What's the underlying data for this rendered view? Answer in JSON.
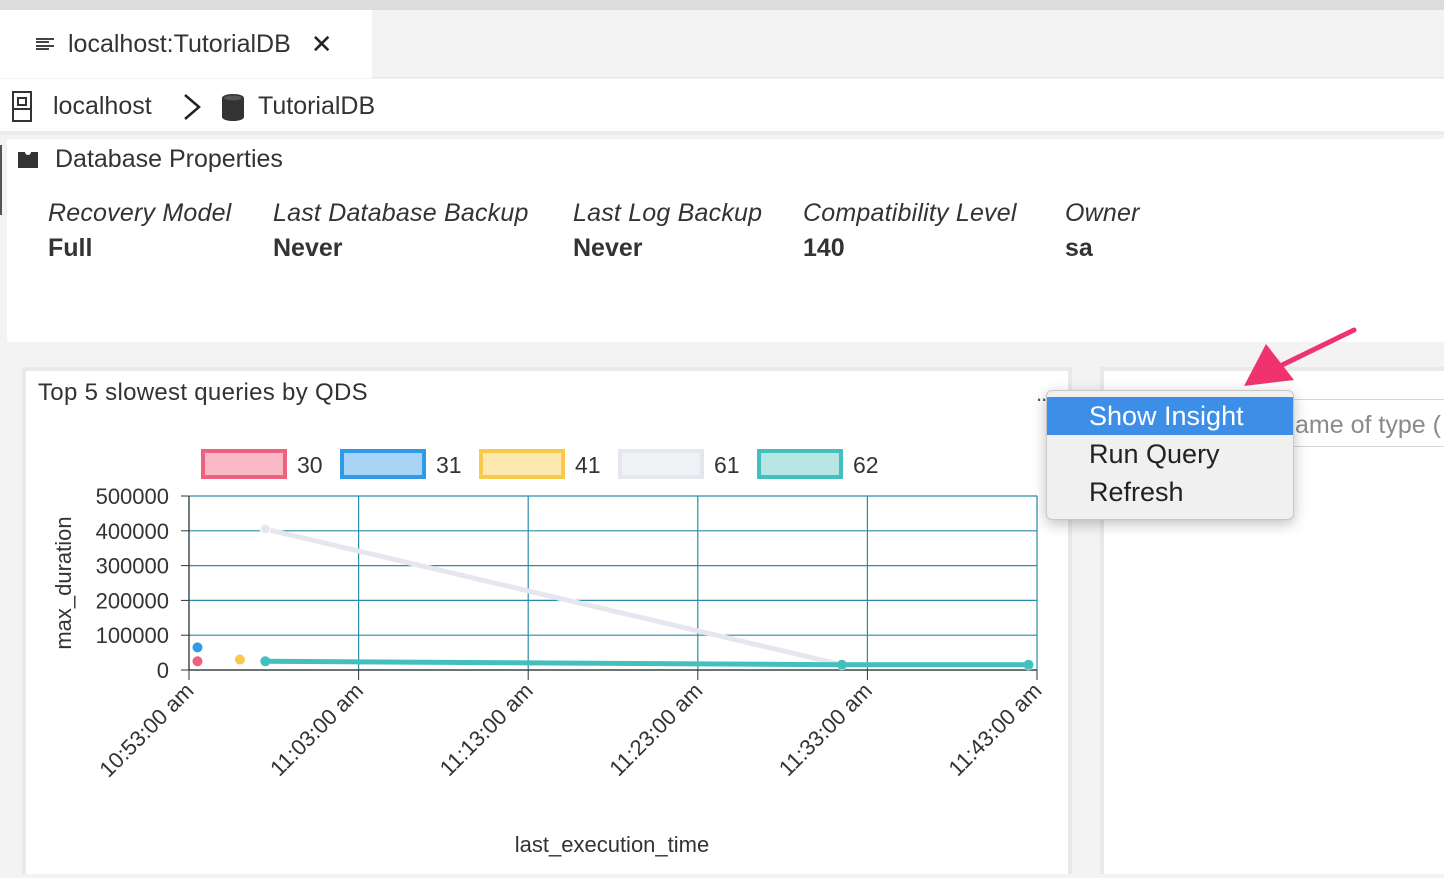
{
  "tab": {
    "title": "localhost:TutorialDB",
    "icon": "document-lines-icon",
    "close_icon": "close-icon"
  },
  "breadcrumb": {
    "server": "localhost",
    "database": "TutorialDB"
  },
  "properties": {
    "title": "Database Properties",
    "items": [
      {
        "label": "Recovery Model",
        "value": "Full"
      },
      {
        "label": "Last Database Backup",
        "value": "Never"
      },
      {
        "label": "Last Log Backup",
        "value": "Never"
      },
      {
        "label": "Compatibility Level",
        "value": "140"
      },
      {
        "label": "Owner",
        "value": "sa"
      }
    ]
  },
  "chart_panel": {
    "title": "Top 5 slowest queries by QDS",
    "menu_label": "..."
  },
  "context_menu": {
    "items": [
      "Show Insight",
      "Run Query",
      "Refresh"
    ],
    "highlighted": "Show Insight"
  },
  "right_panel": {
    "input_fragment": "ame of type ("
  },
  "colors": {
    "accent": "#3d8ee6",
    "arrow": "#f0336f",
    "grid": "#2a8cab"
  },
  "chart_data": {
    "type": "line",
    "title": "Top 5 slowest queries by QDS",
    "xlabel": "last_execution_time",
    "ylabel": "max_duration",
    "ylim": [
      0,
      500000
    ],
    "y_ticks": [
      "500000",
      "400000",
      "300000",
      "200000",
      "100000",
      "0"
    ],
    "x_ticks": [
      "10:53:00 am",
      "11:03:00 am",
      "11:13:00 am",
      "11:23:00 am",
      "11:33:00 am",
      "11:43:00 am"
    ],
    "legend_placement": "top",
    "grid": true,
    "series": [
      {
        "name": "30",
        "color": "#f0617f",
        "fill": "#f9b9c6",
        "points": [
          [
            "10:53:30 am",
            25000
          ]
        ]
      },
      {
        "name": "31",
        "color": "#2f9ae8",
        "fill": "#a9d3f4",
        "points": [
          [
            "10:53:30 am",
            65000
          ]
        ]
      },
      {
        "name": "41",
        "color": "#f8c94a",
        "fill": "#fde9b0",
        "points": [
          [
            "10:56:00 am",
            30000
          ]
        ]
      },
      {
        "name": "61",
        "color": "#e6e7ee",
        "fill": "#f0f1f4",
        "points": [
          [
            "10:57:30 am",
            405000
          ],
          [
            "11:31:30 am",
            15000
          ],
          [
            "11:42:30 am",
            15000
          ]
        ]
      },
      {
        "name": "62",
        "color": "#43c0bd",
        "fill": "#b7e6e5",
        "points": [
          [
            "10:57:30 am",
            25000
          ],
          [
            "11:31:30 am",
            15000
          ],
          [
            "11:42:30 am",
            15000
          ]
        ]
      }
    ]
  }
}
